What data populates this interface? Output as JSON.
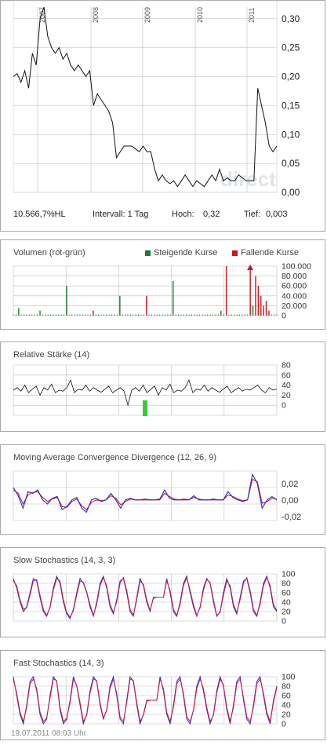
{
  "chart_data": [
    {
      "type": "line",
      "title": "",
      "x_labels": [
        "2007",
        "2008",
        "2009",
        "2010",
        "2011"
      ],
      "y_ticks": [
        "0,30",
        "0,25",
        "0,20",
        "0,15",
        "0,10",
        "0,05",
        "0,00"
      ],
      "y_tick_values": [
        0.3,
        0.25,
        0.2,
        0.15,
        0.1,
        0.05,
        0.0
      ],
      "ylim": [
        0,
        0.32
      ],
      "grid": true,
      "watermark": "direct",
      "series": [
        {
          "values": [
            0.2,
            0.205,
            0.19,
            0.21,
            0.18,
            0.24,
            0.22,
            0.3,
            0.32,
            0.27,
            0.25,
            0.24,
            0.25,
            0.23,
            0.24,
            0.22,
            0.21,
            0.22,
            0.21,
            0.2,
            0.21,
            0.15,
            0.17,
            0.16,
            0.15,
            0.14,
            0.12,
            0.06,
            0.07,
            0.08,
            0.08,
            0.08,
            0.075,
            0.07,
            0.08,
            0.07,
            0.07,
            0.04,
            0.02,
            0.03,
            0.02,
            0.015,
            0.02,
            0.01,
            0.02,
            0.03,
            0.02,
            0.01,
            0.02,
            0.015,
            0.01,
            0.02,
            0.03,
            0.02,
            0.04,
            0.02,
            0.025,
            0.02,
            0.02,
            0.03,
            0.025,
            0.02,
            0.02,
            0.02,
            0.18,
            0.15,
            0.12,
            0.08,
            0.07,
            0.08
          ]
        }
      ]
    },
    {
      "type": "bar",
      "title": "Volumen (rot-grün)",
      "y_ticks": [
        "100.000",
        "80.000",
        "60.000",
        "40.000",
        "20.000",
        "0"
      ],
      "ylim": [
        0,
        100000
      ],
      "grid": true,
      "legend": [
        "Steigende Kurse",
        "Fallende Kurse"
      ],
      "legend_colors": [
        "#1a7a2e",
        "#c8161d"
      ],
      "series": [
        {
          "name": "Steigende Kurse",
          "values": [
            0,
            0,
            15000,
            0,
            0,
            0,
            0,
            0,
            0,
            0,
            10000,
            0,
            0,
            0,
            0,
            0,
            0,
            0,
            0,
            0,
            60000,
            0,
            0,
            0,
            0,
            0,
            0,
            0,
            0,
            0,
            0,
            0,
            0,
            0,
            0,
            0,
            0,
            0,
            0,
            0,
            40000,
            0,
            0,
            0,
            0,
            0,
            0,
            0,
            0,
            0,
            0,
            0,
            0,
            0,
            0,
            0,
            0,
            0,
            0,
            0,
            70000,
            0,
            0,
            0,
            0,
            0,
            0,
            0,
            0,
            0,
            0,
            0,
            0,
            0,
            0,
            0,
            0,
            0,
            10000,
            0,
            0,
            0,
            0,
            0,
            0,
            0,
            0,
            0,
            0,
            0,
            20000,
            0,
            0,
            0,
            0,
            0,
            0,
            0,
            0,
            0
          ]
        },
        {
          "name": "Fallende Kurse",
          "values": [
            0,
            0,
            0,
            0,
            0,
            0,
            0,
            0,
            0,
            0,
            0,
            0,
            0,
            0,
            0,
            0,
            0,
            0,
            0,
            0,
            0,
            0,
            0,
            0,
            0,
            0,
            0,
            0,
            0,
            0,
            10000,
            0,
            0,
            0,
            0,
            0,
            0,
            0,
            0,
            0,
            0,
            0,
            0,
            0,
            0,
            0,
            0,
            0,
            0,
            0,
            40000,
            0,
            0,
            0,
            0,
            0,
            0,
            0,
            0,
            0,
            0,
            0,
            0,
            0,
            0,
            0,
            0,
            0,
            0,
            0,
            0,
            0,
            0,
            0,
            0,
            0,
            0,
            0,
            0,
            0,
            100000,
            0,
            0,
            0,
            0,
            0,
            0,
            0,
            0,
            100000,
            0,
            80000,
            60000,
            40000,
            20000,
            30000,
            10000,
            0,
            0,
            0
          ]
        }
      ]
    },
    {
      "type": "line",
      "title": "Relative Stärke (14)",
      "y_ticks": [
        "80",
        "60",
        "40",
        "20",
        "0"
      ],
      "ylim": [
        0,
        100
      ],
      "grid": true,
      "series": [
        {
          "values": [
            50,
            55,
            48,
            60,
            45,
            52,
            58,
            40,
            55,
            50,
            62,
            45,
            50,
            48,
            55,
            70,
            45,
            52,
            50,
            60,
            48,
            55,
            50,
            46,
            52,
            58,
            45,
            50,
            55,
            48,
            20,
            50,
            55,
            48,
            60,
            45,
            52,
            58,
            40,
            55,
            50,
            62,
            45,
            50,
            48,
            55,
            70,
            45,
            52,
            50,
            60,
            48,
            55,
            50,
            46,
            52,
            58,
            45,
            50,
            55,
            48,
            52,
            50,
            55,
            60,
            50,
            45,
            55,
            50,
            52
          ]
        }
      ]
    },
    {
      "type": "line",
      "title": "Moving Average Convergence Divergence (12, 26, 9)",
      "y_ticks": [
        "0,02",
        "0,00",
        "-0,02"
      ],
      "ylim": [
        -0.025,
        0.035
      ],
      "grid": true,
      "series": [
        {
          "values": [
            0.015,
            0.005,
            -0.01,
            0.01,
            0.008,
            0.012,
            0.0,
            -0.005,
            0.002,
            0.004,
            -0.012,
            -0.008,
            0.0,
            0.003,
            -0.01,
            -0.015,
            0.0,
            0.002,
            -0.002,
            0.0,
            0.008,
            0.0,
            -0.01,
            0.0,
            0.002,
            0.0,
            0.0,
            0.001,
            0.0,
            0.0,
            0.001,
            0.012,
            0.002,
            0.0,
            0.0,
            0.001,
            0.0,
            0.005,
            0.0,
            0.0,
            0.0,
            0.001,
            0.0,
            0.0,
            0.01,
            0.003,
            0.0,
            -0.002,
            0.0,
            0.031,
            0.02,
            -0.01,
            0.0,
            0.004,
            0.0
          ]
        },
        {
          "values": [
            0.012,
            0.008,
            -0.005,
            0.006,
            0.009,
            0.01,
            0.003,
            -0.002,
            0.001,
            0.003,
            -0.008,
            -0.009,
            -0.002,
            0.001,
            -0.007,
            -0.012,
            -0.003,
            0.0,
            -0.001,
            0.0,
            0.005,
            0.002,
            -0.006,
            -0.002,
            0.001,
            0.0,
            0.0,
            0.0,
            0.0,
            0.0,
            0.0,
            0.008,
            0.004,
            0.001,
            0.0,
            0.0,
            0.0,
            0.003,
            0.001,
            0.0,
            0.0,
            0.0,
            0.0,
            0.0,
            0.006,
            0.004,
            0.001,
            -0.001,
            0.0,
            0.025,
            0.022,
            -0.004,
            -0.002,
            0.002,
            0.001
          ]
        }
      ]
    },
    {
      "type": "line",
      "title": "Slow Stochastics (14, 3, 3)",
      "y_ticks": [
        "100",
        "80",
        "60",
        "40",
        "20",
        "0"
      ],
      "ylim": [
        0,
        100
      ],
      "grid": true,
      "series": [
        {
          "values": [
            90,
            70,
            40,
            20,
            30,
            60,
            90,
            85,
            50,
            20,
            10,
            30,
            70,
            95,
            80,
            40,
            15,
            5,
            25,
            60,
            90,
            80,
            60,
            30,
            10,
            40,
            80,
            95,
            70,
            30,
            15,
            45,
            85,
            90,
            60,
            20,
            10,
            50,
            90,
            75,
            40,
            20,
            50,
            50,
            50,
            50,
            90,
            60,
            20,
            10,
            40,
            80,
            95,
            60,
            30,
            10,
            30,
            70,
            90,
            80,
            40,
            10,
            20,
            60,
            90,
            70,
            30,
            15,
            50,
            85,
            90,
            60,
            20,
            10,
            40,
            80,
            95,
            70,
            30,
            20
          ]
        },
        {
          "values": [
            85,
            75,
            45,
            25,
            28,
            55,
            85,
            88,
            55,
            25,
            12,
            28,
            65,
            90,
            85,
            45,
            18,
            8,
            22,
            55,
            85,
            82,
            62,
            35,
            12,
            35,
            75,
            92,
            75,
            35,
            18,
            40,
            80,
            92,
            65,
            25,
            12,
            45,
            85,
            78,
            45,
            22,
            48,
            50,
            50,
            50,
            85,
            65,
            25,
            12,
            35,
            75,
            92,
            65,
            35,
            12,
            28,
            65,
            88,
            82,
            45,
            12,
            18,
            55,
            85,
            75,
            35,
            18,
            45,
            80,
            92,
            65,
            25,
            12,
            35,
            75,
            92,
            75,
            35,
            22
          ]
        }
      ]
    },
    {
      "type": "line",
      "title": "Fast Stochastics (14, 3)",
      "y_ticks": [
        "100",
        "80",
        "60",
        "40",
        "20",
        "0"
      ],
      "ylim": [
        0,
        100
      ],
      "grid": true,
      "series": [
        {
          "values": [
            100,
            60,
            20,
            0,
            40,
            90,
            100,
            70,
            20,
            0,
            10,
            60,
            100,
            90,
            30,
            0,
            10,
            50,
            100,
            80,
            40,
            0,
            20,
            70,
            100,
            90,
            40,
            10,
            30,
            80,
            100,
            60,
            10,
            0,
            50,
            100,
            90,
            40,
            0,
            20,
            50,
            50,
            50,
            50,
            100,
            70,
            20,
            0,
            40,
            90,
            100,
            60,
            10,
            0,
            30,
            80,
            100,
            70,
            30,
            0,
            20,
            70,
            100,
            80,
            30,
            0,
            40,
            90,
            100,
            50,
            10,
            0,
            40,
            90,
            100,
            60,
            20,
            0,
            50,
            80
          ]
        },
        {
          "values": [
            95,
            65,
            25,
            5,
            35,
            85,
            95,
            75,
            25,
            5,
            12,
            55,
            95,
            92,
            35,
            5,
            12,
            45,
            95,
            82,
            45,
            5,
            18,
            65,
            95,
            92,
            45,
            12,
            28,
            75,
            95,
            65,
            15,
            5,
            45,
            95,
            92,
            45,
            5,
            18,
            48,
            50,
            50,
            50,
            95,
            75,
            25,
            5,
            35,
            85,
            95,
            65,
            15,
            5,
            28,
            75,
            95,
            75,
            35,
            5,
            18,
            65,
            95,
            82,
            35,
            5,
            35,
            85,
            95,
            55,
            15,
            5,
            35,
            85,
            95,
            65,
            25,
            5,
            45,
            78
          ]
        }
      ]
    }
  ],
  "price_info": {
    "change": "10.566,7%HL",
    "interval": "Intervall: 1 Tag",
    "high_label": "Hoch:",
    "high_value": "0,32",
    "low_label": "Tief:",
    "low_value": "0,003"
  },
  "footer": "19.07.2011 08:03 Uhr",
  "colors": {
    "price_line": "#111111",
    "grid": "#bdbdbd",
    "up": "#1a7a2e",
    "down": "#c8161d",
    "macd": "#2a2ad0",
    "signal": "#d01a3a",
    "stoch_k": "#2a2ad0",
    "stoch_d": "#d01a3a",
    "rsi_bar": "#33cc33",
    "watermark": "#dfe3ea"
  }
}
